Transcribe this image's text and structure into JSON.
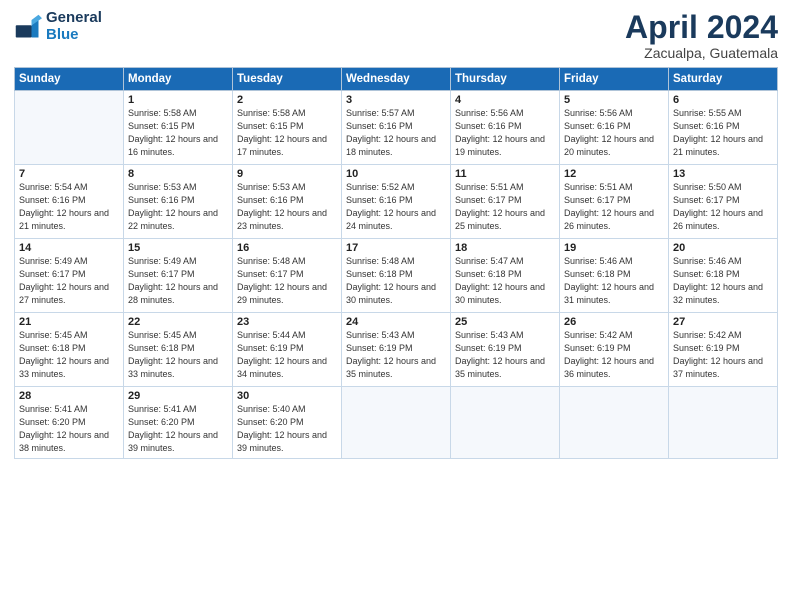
{
  "header": {
    "logo_line1": "General",
    "logo_line2": "Blue",
    "month": "April 2024",
    "location": "Zacualpa, Guatemala"
  },
  "weekdays": [
    "Sunday",
    "Monday",
    "Tuesday",
    "Wednesday",
    "Thursday",
    "Friday",
    "Saturday"
  ],
  "weeks": [
    [
      {
        "day": "",
        "sunrise": "",
        "sunset": "",
        "daylight": ""
      },
      {
        "day": "1",
        "sunrise": "Sunrise: 5:58 AM",
        "sunset": "Sunset: 6:15 PM",
        "daylight": "Daylight: 12 hours and 16 minutes."
      },
      {
        "day": "2",
        "sunrise": "Sunrise: 5:58 AM",
        "sunset": "Sunset: 6:15 PM",
        "daylight": "Daylight: 12 hours and 17 minutes."
      },
      {
        "day": "3",
        "sunrise": "Sunrise: 5:57 AM",
        "sunset": "Sunset: 6:16 PM",
        "daylight": "Daylight: 12 hours and 18 minutes."
      },
      {
        "day": "4",
        "sunrise": "Sunrise: 5:56 AM",
        "sunset": "Sunset: 6:16 PM",
        "daylight": "Daylight: 12 hours and 19 minutes."
      },
      {
        "day": "5",
        "sunrise": "Sunrise: 5:56 AM",
        "sunset": "Sunset: 6:16 PM",
        "daylight": "Daylight: 12 hours and 20 minutes."
      },
      {
        "day": "6",
        "sunrise": "Sunrise: 5:55 AM",
        "sunset": "Sunset: 6:16 PM",
        "daylight": "Daylight: 12 hours and 21 minutes."
      }
    ],
    [
      {
        "day": "7",
        "sunrise": "Sunrise: 5:54 AM",
        "sunset": "Sunset: 6:16 PM",
        "daylight": "Daylight: 12 hours and 21 minutes."
      },
      {
        "day": "8",
        "sunrise": "Sunrise: 5:53 AM",
        "sunset": "Sunset: 6:16 PM",
        "daylight": "Daylight: 12 hours and 22 minutes."
      },
      {
        "day": "9",
        "sunrise": "Sunrise: 5:53 AM",
        "sunset": "Sunset: 6:16 PM",
        "daylight": "Daylight: 12 hours and 23 minutes."
      },
      {
        "day": "10",
        "sunrise": "Sunrise: 5:52 AM",
        "sunset": "Sunset: 6:16 PM",
        "daylight": "Daylight: 12 hours and 24 minutes."
      },
      {
        "day": "11",
        "sunrise": "Sunrise: 5:51 AM",
        "sunset": "Sunset: 6:17 PM",
        "daylight": "Daylight: 12 hours and 25 minutes."
      },
      {
        "day": "12",
        "sunrise": "Sunrise: 5:51 AM",
        "sunset": "Sunset: 6:17 PM",
        "daylight": "Daylight: 12 hours and 26 minutes."
      },
      {
        "day": "13",
        "sunrise": "Sunrise: 5:50 AM",
        "sunset": "Sunset: 6:17 PM",
        "daylight": "Daylight: 12 hours and 26 minutes."
      }
    ],
    [
      {
        "day": "14",
        "sunrise": "Sunrise: 5:49 AM",
        "sunset": "Sunset: 6:17 PM",
        "daylight": "Daylight: 12 hours and 27 minutes."
      },
      {
        "day": "15",
        "sunrise": "Sunrise: 5:49 AM",
        "sunset": "Sunset: 6:17 PM",
        "daylight": "Daylight: 12 hours and 28 minutes."
      },
      {
        "day": "16",
        "sunrise": "Sunrise: 5:48 AM",
        "sunset": "Sunset: 6:17 PM",
        "daylight": "Daylight: 12 hours and 29 minutes."
      },
      {
        "day": "17",
        "sunrise": "Sunrise: 5:48 AM",
        "sunset": "Sunset: 6:18 PM",
        "daylight": "Daylight: 12 hours and 30 minutes."
      },
      {
        "day": "18",
        "sunrise": "Sunrise: 5:47 AM",
        "sunset": "Sunset: 6:18 PM",
        "daylight": "Daylight: 12 hours and 30 minutes."
      },
      {
        "day": "19",
        "sunrise": "Sunrise: 5:46 AM",
        "sunset": "Sunset: 6:18 PM",
        "daylight": "Daylight: 12 hours and 31 minutes."
      },
      {
        "day": "20",
        "sunrise": "Sunrise: 5:46 AM",
        "sunset": "Sunset: 6:18 PM",
        "daylight": "Daylight: 12 hours and 32 minutes."
      }
    ],
    [
      {
        "day": "21",
        "sunrise": "Sunrise: 5:45 AM",
        "sunset": "Sunset: 6:18 PM",
        "daylight": "Daylight: 12 hours and 33 minutes."
      },
      {
        "day": "22",
        "sunrise": "Sunrise: 5:45 AM",
        "sunset": "Sunset: 6:18 PM",
        "daylight": "Daylight: 12 hours and 33 minutes."
      },
      {
        "day": "23",
        "sunrise": "Sunrise: 5:44 AM",
        "sunset": "Sunset: 6:19 PM",
        "daylight": "Daylight: 12 hours and 34 minutes."
      },
      {
        "day": "24",
        "sunrise": "Sunrise: 5:43 AM",
        "sunset": "Sunset: 6:19 PM",
        "daylight": "Daylight: 12 hours and 35 minutes."
      },
      {
        "day": "25",
        "sunrise": "Sunrise: 5:43 AM",
        "sunset": "Sunset: 6:19 PM",
        "daylight": "Daylight: 12 hours and 35 minutes."
      },
      {
        "day": "26",
        "sunrise": "Sunrise: 5:42 AM",
        "sunset": "Sunset: 6:19 PM",
        "daylight": "Daylight: 12 hours and 36 minutes."
      },
      {
        "day": "27",
        "sunrise": "Sunrise: 5:42 AM",
        "sunset": "Sunset: 6:19 PM",
        "daylight": "Daylight: 12 hours and 37 minutes."
      }
    ],
    [
      {
        "day": "28",
        "sunrise": "Sunrise: 5:41 AM",
        "sunset": "Sunset: 6:20 PM",
        "daylight": "Daylight: 12 hours and 38 minutes."
      },
      {
        "day": "29",
        "sunrise": "Sunrise: 5:41 AM",
        "sunset": "Sunset: 6:20 PM",
        "daylight": "Daylight: 12 hours and 39 minutes."
      },
      {
        "day": "30",
        "sunrise": "Sunrise: 5:40 AM",
        "sunset": "Sunset: 6:20 PM",
        "daylight": "Daylight: 12 hours and 39 minutes."
      },
      {
        "day": "",
        "sunrise": "",
        "sunset": "",
        "daylight": ""
      },
      {
        "day": "",
        "sunrise": "",
        "sunset": "",
        "daylight": ""
      },
      {
        "day": "",
        "sunrise": "",
        "sunset": "",
        "daylight": ""
      },
      {
        "day": "",
        "sunrise": "",
        "sunset": "",
        "daylight": ""
      }
    ]
  ]
}
